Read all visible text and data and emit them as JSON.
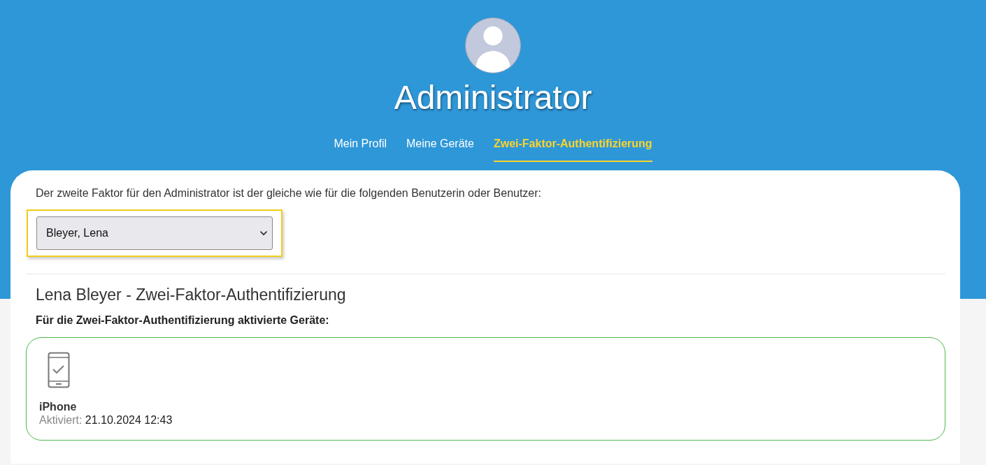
{
  "header": {
    "title": "Administrator"
  },
  "tabs": [
    {
      "label": "Mein Profil",
      "selected": false
    },
    {
      "label": "Meine Geräte",
      "selected": false
    },
    {
      "label": "Zwei-Faktor-Authentifizierung",
      "selected": true
    }
  ],
  "intro": "Der zweite Faktor für den Administrator ist der gleiche wie für die folgenden Benutzerin oder Benutzer:",
  "user_select": {
    "value": "Bleyer, Lena"
  },
  "section_title": "Lena Bleyer - Zwei-Faktor-Authentifizierung",
  "devices_label": "Für die Zwei-Faktor-Authentifizierung aktivierte Geräte:",
  "devices": [
    {
      "name": "iPhone",
      "activated_label": "Aktiviert:",
      "activated_at": "21.10.2024 12:43"
    }
  ]
}
